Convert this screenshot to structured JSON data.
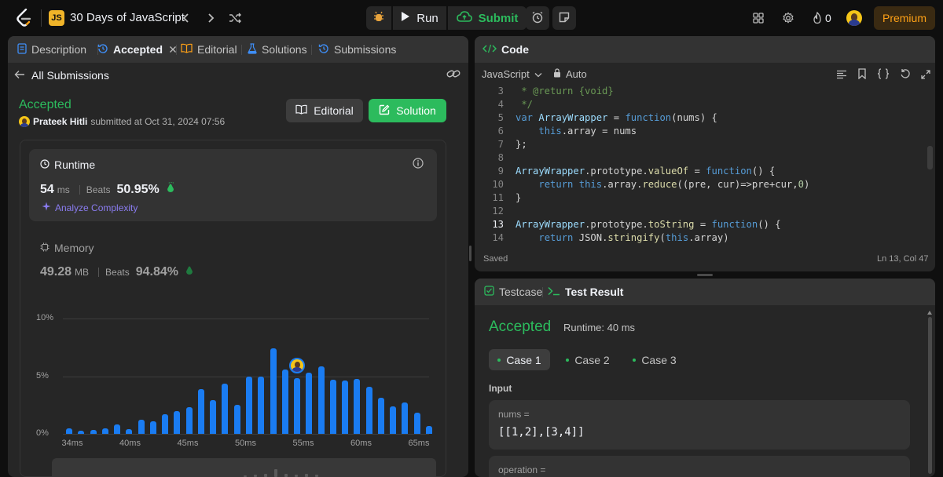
{
  "topbar": {
    "study_badge": "JS",
    "study_title": "30 Days of JavaScript",
    "run_label": "Run",
    "submit_label": "Submit",
    "streak_count": "0",
    "premium_label": "Premium"
  },
  "left_panel": {
    "tabs": [
      {
        "label": "Description",
        "icon": "description-icon"
      },
      {
        "label": "Accepted",
        "icon": "history-icon"
      },
      {
        "label": "Editorial",
        "icon": "book-icon"
      },
      {
        "label": "Solutions",
        "icon": "flask-icon"
      },
      {
        "label": "Submissions",
        "icon": "history-icon"
      }
    ],
    "back_label": "All Submissions",
    "status": "Accepted",
    "user_name": "Prateek Hitli",
    "submitted_text": "submitted at Oct 31, 2024 07:56",
    "editorial_btn": "Editorial",
    "solution_btn": "Solution",
    "runtime": {
      "label": "Runtime",
      "value": "54",
      "unit": "ms",
      "beats_label": "Beats",
      "beats_value": "50.95%",
      "analyze_label": "Analyze Complexity"
    },
    "memory": {
      "label": "Memory",
      "value": "49.28",
      "unit": "MB",
      "beats_label": "Beats",
      "beats_value": "94.84%"
    }
  },
  "chart_data": {
    "type": "bar",
    "y_ticks": [
      "10%",
      "5%",
      "0%"
    ],
    "ylim": [
      0,
      10
    ],
    "x_ticks": [
      "34ms",
      "40ms",
      "45ms",
      "50ms",
      "55ms",
      "60ms",
      "65ms"
    ],
    "values": [
      0.5,
      0.3,
      0.35,
      0.5,
      0.85,
      0.4,
      1.25,
      1.1,
      1.7,
      1.95,
      2.3,
      3.9,
      2.9,
      4.35,
      2.5,
      5.0,
      4.95,
      7.4,
      5.6,
      4.85,
      5.3,
      5.85,
      4.7,
      4.65,
      4.75,
      4.1,
      3.1,
      2.4,
      2.75,
      1.85,
      0.65
    ],
    "user_bar_index": 19,
    "bar_color": "#1a7cf2"
  },
  "code_panel": {
    "title": "Code",
    "language": "JavaScript",
    "mode": "Auto",
    "current_line": 13,
    "lines": [
      {
        "n": "3",
        "t": " * @return {void}"
      },
      {
        "n": "4",
        "t": " */"
      },
      {
        "n": "5",
        "t": "var ArrayWrapper = function(nums) {"
      },
      {
        "n": "6",
        "t": "    this.array = nums"
      },
      {
        "n": "7",
        "t": "};"
      },
      {
        "n": "8",
        "t": ""
      },
      {
        "n": "9",
        "t": "ArrayWrapper.prototype.valueOf = function() {"
      },
      {
        "n": "10",
        "t": "    return this.array.reduce((pre, cur)=>pre+cur,0)"
      },
      {
        "n": "11",
        "t": "}"
      },
      {
        "n": "12",
        "t": ""
      },
      {
        "n": "13",
        "t": "ArrayWrapper.prototype.toString = function() {"
      },
      {
        "n": "14",
        "t": "    return JSON.stringify(this.array)"
      }
    ],
    "status": "Saved",
    "cursor": "Ln 13, Col 47"
  },
  "test_panel": {
    "tabs": [
      "Testcase",
      "Test Result"
    ],
    "status": "Accepted",
    "runtime_text": "Runtime: 40 ms",
    "cases": [
      "Case 1",
      "Case 2",
      "Case 3"
    ],
    "input_label": "Input",
    "param1_name": "nums =",
    "param1_value": "[[1,2],[3,4]]",
    "param2_name": "operation ="
  },
  "colors": {
    "accent_green": "#2cbb5d",
    "premium_orange": "#ffa116",
    "bar_blue": "#1a7cf2",
    "analyze_purple": "#8a7cf0"
  }
}
